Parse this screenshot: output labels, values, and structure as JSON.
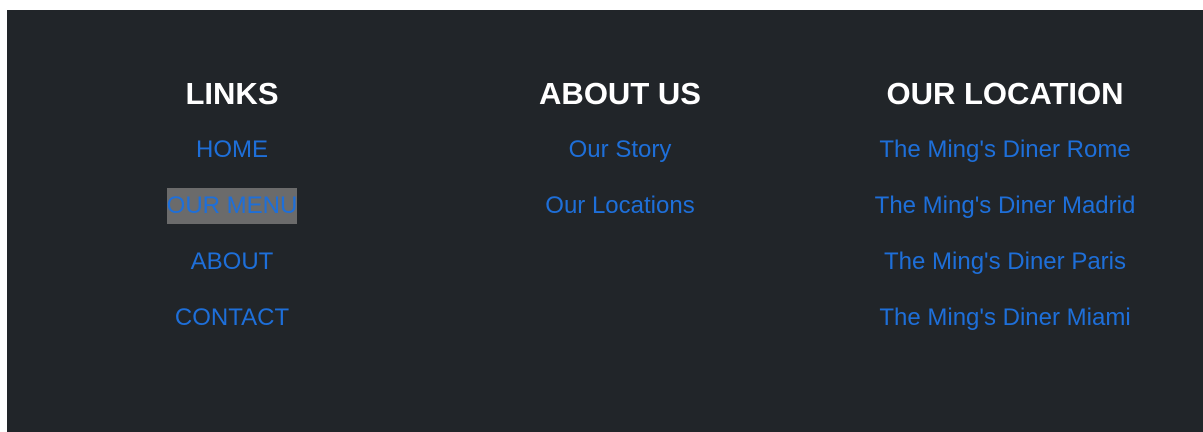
{
  "footer": {
    "links": {
      "heading": "LINKS",
      "items": [
        {
          "label": "HOME"
        },
        {
          "label": "OUR MENU"
        },
        {
          "label": "ABOUT"
        },
        {
          "label": "CONTACT"
        }
      ]
    },
    "about": {
      "heading": "ABOUT US",
      "items": [
        {
          "label": "Our Story"
        },
        {
          "label": "Our Locations"
        }
      ]
    },
    "location": {
      "heading": "OUR LOCATION",
      "items": [
        {
          "label": "The Ming's Diner Rome"
        },
        {
          "label": "The Ming's Diner Madrid"
        },
        {
          "label": "The Ming's Diner Paris"
        },
        {
          "label": "The Ming's Diner Miami"
        }
      ]
    }
  },
  "colors": {
    "background": "#212529",
    "heading": "#ffffff",
    "link": "#1e6fd9",
    "highlight": "#6b6b6b"
  }
}
